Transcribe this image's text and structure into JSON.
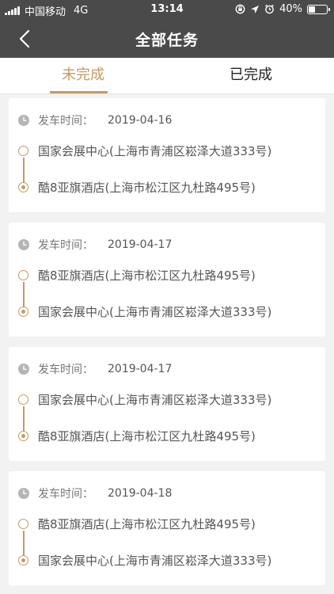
{
  "status_bar": {
    "carrier": "中国移动",
    "network": "4G",
    "time": "13:14",
    "battery": "40%",
    "battery_level": 0.4
  },
  "nav": {
    "title": "全部任务"
  },
  "tabs": [
    {
      "label": "未完成"
    },
    {
      "label": "已完成"
    }
  ],
  "colors": {
    "accent": "#c59a62",
    "header_bg": "#4a4a4a",
    "page_bg": "#f2f2f2"
  },
  "tasks": [
    {
      "time_label": "发车时间：",
      "date": "2019-04-16",
      "from": "国家会展中心(上海市青浦区崧泽大道333号)",
      "to": "酷8亚旗酒店(上海市松江区九杜路495号)"
    },
    {
      "time_label": "发车时间：",
      "date": "2019-04-17",
      "from": "酷8亚旗酒店(上海市松江区九杜路495号)",
      "to": "国家会展中心(上海市青浦区崧泽大道333号)"
    },
    {
      "time_label": "发车时间：",
      "date": "2019-04-17",
      "from": "国家会展中心(上海市青浦区崧泽大道333号)",
      "to": "酷8亚旗酒店(上海市松江区九杜路495号)"
    },
    {
      "time_label": "发车时间：",
      "date": "2019-04-18",
      "from": "酷8亚旗酒店(上海市松江区九杜路495号)",
      "to": "国家会展中心(上海市青浦区崧泽大道333号)"
    }
  ]
}
